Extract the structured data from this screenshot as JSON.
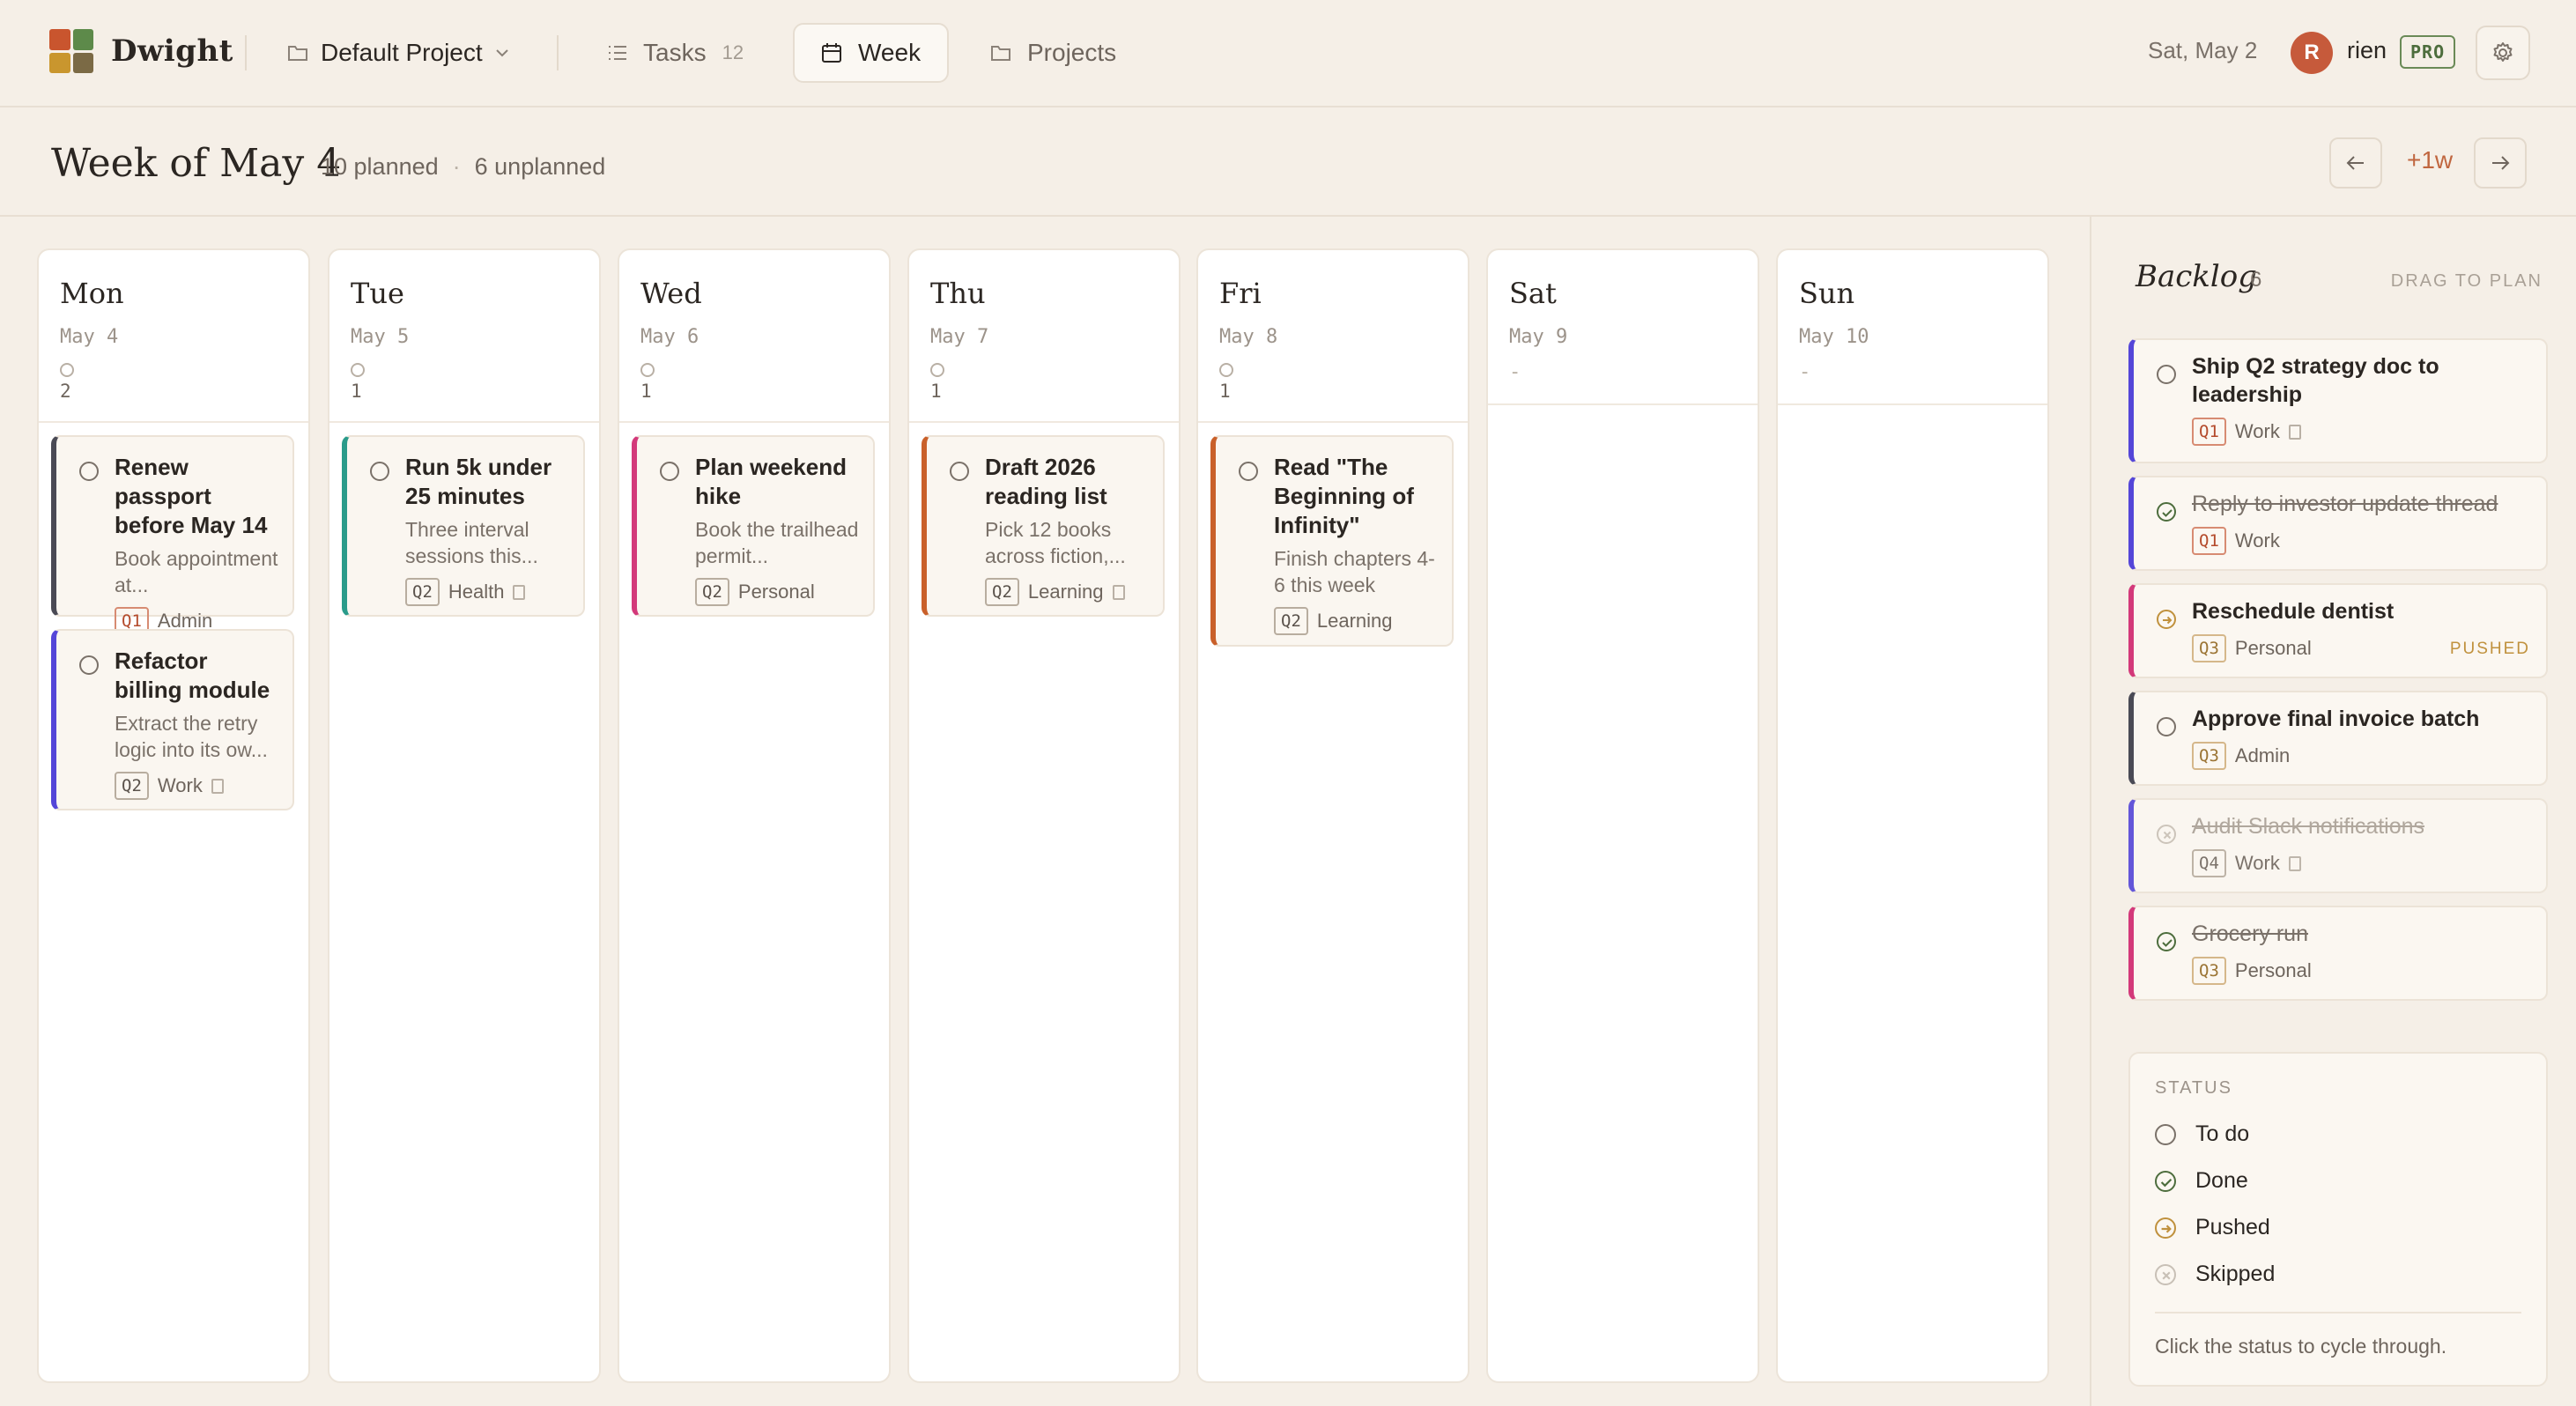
{
  "app": {
    "name": "Dwight",
    "project": "Default Project",
    "nav": [
      {
        "label": "Tasks",
        "count": "12"
      },
      {
        "label": "Week"
      },
      {
        "label": "Projects"
      }
    ],
    "today": "Sat, May 2",
    "user": {
      "initial": "R",
      "name": "rien",
      "plan": "PRO"
    }
  },
  "week": {
    "title": "Week of May 4",
    "planned": "10 planned",
    "separator": "·",
    "unplanned": "6 unplanned",
    "jump_label": "+1w"
  },
  "days": [
    {
      "name": "Mon",
      "date": "May 4",
      "count": "2",
      "tasks": [
        {
          "title": "Renew passport before May 14",
          "desc": "Book appointment at...",
          "quadrant": "Q1",
          "area": "Admin",
          "color": "#4a4a55",
          "note": false
        },
        {
          "title": "Refactor billing module",
          "desc": "Extract the retry logic into its ow...",
          "quadrant": "Q2",
          "area": "Work",
          "color": "#5446d8",
          "note": true
        }
      ]
    },
    {
      "name": "Tue",
      "date": "May 5",
      "count": "1",
      "tasks": [
        {
          "title": "Run 5k under 25 minutes",
          "desc": "Three interval sessions this...",
          "quadrant": "Q2",
          "area": "Health",
          "color": "#2a9b8a",
          "note": true
        }
      ]
    },
    {
      "name": "Wed",
      "date": "May 6",
      "count": "1",
      "tasks": [
        {
          "title": "Plan weekend hike",
          "desc": "Book the trailhead permit...",
          "quadrant": "Q2",
          "area": "Personal",
          "color": "#d3397a",
          "note": false
        }
      ]
    },
    {
      "name": "Thu",
      "date": "May 7",
      "count": "1",
      "tasks": [
        {
          "title": "Draft 2026 reading list",
          "desc": "Pick 12 books across fiction,...",
          "quadrant": "Q2",
          "area": "Learning",
          "color": "#c9602a",
          "note": true
        }
      ]
    },
    {
      "name": "Fri",
      "date": "May 8",
      "count": "1",
      "tasks": [
        {
          "title": "Read \"The Beginning of Infinity\"",
          "desc": "Finish chapters 4-6 this week",
          "quadrant": "Q2",
          "area": "Learning",
          "color": "#c9602a",
          "note": false
        }
      ]
    },
    {
      "name": "Sat",
      "date": "May 9",
      "count": "-",
      "tasks": []
    },
    {
      "name": "Sun",
      "date": "May 10",
      "count": "-",
      "tasks": []
    }
  ],
  "backlog": {
    "title": "Backlog",
    "count": "6",
    "hint": "DRAG TO PLAN",
    "items": [
      {
        "title": "Ship Q2 strategy doc to leadership",
        "quadrant": "Q1",
        "area": "Work",
        "status": "todo",
        "color": "#5446d8",
        "note": true
      },
      {
        "title": "Reply to investor update thread",
        "quadrant": "Q1",
        "area": "Work",
        "status": "done",
        "color": "#5446d8",
        "note": false
      },
      {
        "title": "Reschedule dentist",
        "quadrant": "Q3",
        "area": "Personal",
        "status": "pushed",
        "color": "#d3397a",
        "note": false,
        "badge": "PUSHED"
      },
      {
        "title": "Approve final invoice batch",
        "quadrant": "Q3",
        "area": "Admin",
        "status": "todo",
        "color": "#4a4a55",
        "note": false
      },
      {
        "title": "Audit Slack notifications",
        "quadrant": "Q4",
        "area": "Work",
        "status": "skipped",
        "color": "#5446d8",
        "note": true
      },
      {
        "title": "Grocery run",
        "quadrant": "Q3",
        "area": "Personal",
        "status": "done",
        "color": "#d3397a",
        "note": false
      }
    ]
  },
  "legend": {
    "heading": "STATUS",
    "items": [
      {
        "label": "To do",
        "icon": "circle-icon"
      },
      {
        "label": "Done",
        "icon": "check-circle-icon"
      },
      {
        "label": "Pushed",
        "icon": "arrow-circle-icon"
      },
      {
        "label": "Skipped",
        "icon": "x-circle-icon"
      }
    ],
    "footer": "Click the status to cycle through."
  },
  "colors": {
    "accent": "#c0663f",
    "done": "#4d6d3d",
    "pushed": "#c0913d",
    "skipped": "#c8c0b6"
  }
}
